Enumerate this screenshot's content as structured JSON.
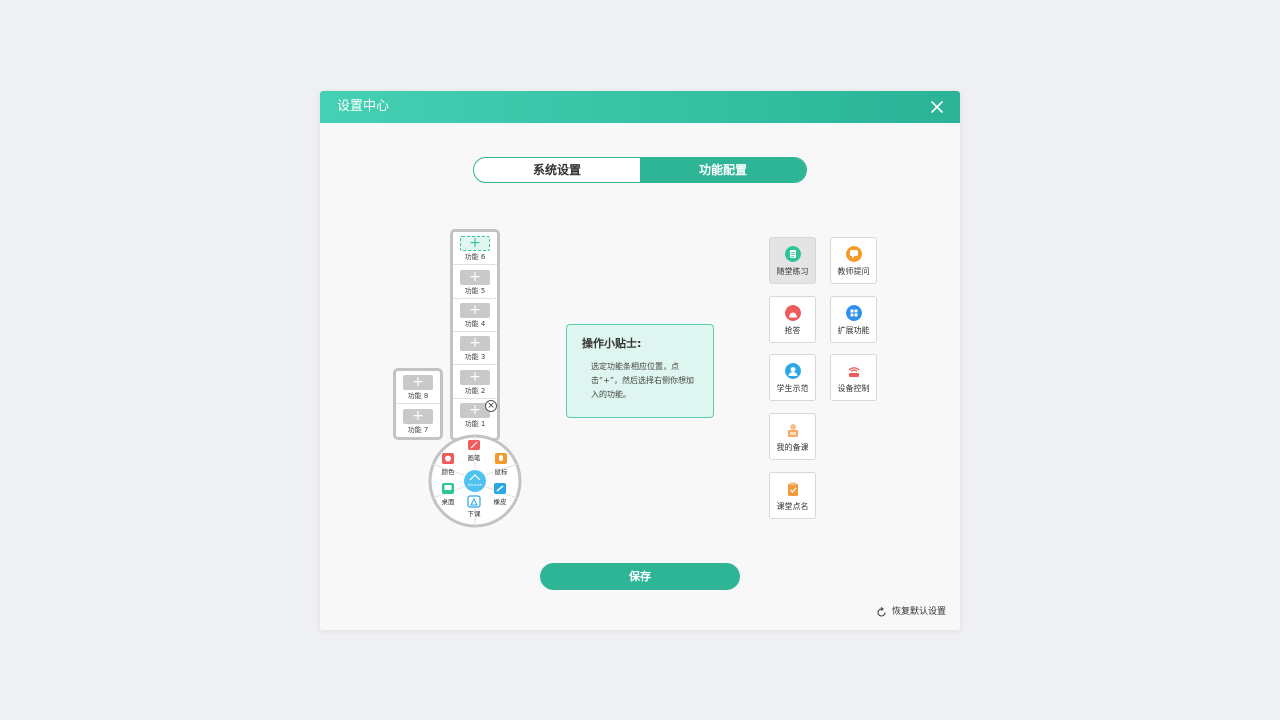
{
  "dialog": {
    "title": "设置中心"
  },
  "tabs": [
    {
      "label": "系统设置",
      "active": false
    },
    {
      "label": "功能配置",
      "active": true
    }
  ],
  "toolbar": {
    "main_slots": [
      {
        "label": "功能 6",
        "selected": true
      },
      {
        "label": "功能 5",
        "selected": false
      },
      {
        "label": "功能 4",
        "selected": false
      },
      {
        "label": "功能 3",
        "selected": false
      },
      {
        "label": "功能 2",
        "selected": false
      },
      {
        "label": "功能 1",
        "selected": false
      }
    ],
    "extra_slots": [
      {
        "label": "功能 8"
      },
      {
        "label": "功能 7"
      }
    ],
    "plus_symbol": "+",
    "remove_symbol": "×",
    "wheel": {
      "items": [
        "画笔",
        "鼠标",
        "橡皮",
        "下课",
        "桌面",
        "颜色"
      ],
      "center_text": "EduLive"
    }
  },
  "tip": {
    "title": "操作小贴士:",
    "body": "选定功能条相应位置，点击“+”，然后选择右侧你想加入的功能。"
  },
  "functions": [
    {
      "label": "随堂练习",
      "icon": "exercise-icon",
      "color": "#2ec49a",
      "selected": true
    },
    {
      "label": "教师提问",
      "icon": "question-icon",
      "color": "#f39a2a",
      "selected": false
    },
    {
      "label": "抢答",
      "icon": "buzzer-icon",
      "color": "#ef5a5a",
      "selected": false
    },
    {
      "label": "扩展功能",
      "icon": "apps-icon",
      "color": "#2e8ff0",
      "selected": false
    },
    {
      "label": "学生示范",
      "icon": "student-icon",
      "color": "#2ba6e6",
      "selected": false
    },
    {
      "label": "设备控制",
      "icon": "device-icon",
      "color": "#ef5a5a",
      "selected": false
    },
    {
      "label": "我的备课",
      "icon": "lesson-icon",
      "color": "#f4a766",
      "selected": false
    },
    {
      "label": "课堂点名",
      "icon": "rollcall-icon",
      "color": "#f39a3a",
      "selected": false
    }
  ],
  "actions": {
    "save_label": "保存",
    "restore_label": "恢复默认设置"
  },
  "colors": {
    "accent": "#2eb596",
    "header_start": "#45d0b4",
    "header_end": "#2ab396"
  }
}
